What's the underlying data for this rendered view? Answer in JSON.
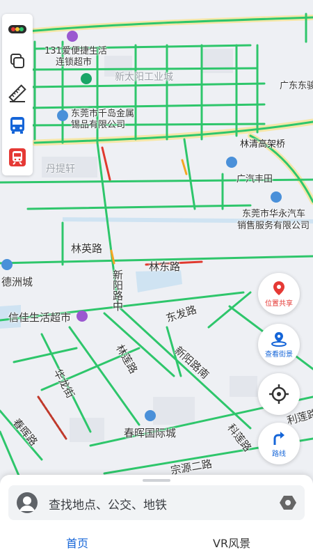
{
  "map": {
    "labels": {
      "shop131": "131爱便捷生活",
      "shop131b": "连锁超市",
      "xintaiyang": "新太阳工业城",
      "guangdong": "广东东骏",
      "qiandao1": "东莞市千岛金属",
      "qiandao2": "锡品有限公司",
      "linqing": "林清高架桥",
      "danti": "丹提轩",
      "guangqi": "广汽丰田",
      "huayong1": "东莞市华永汽车",
      "huayong2": "销售服务有限公司",
      "linying": "林英路",
      "lindong": "林东路",
      "dezhou": "德洲城",
      "xinyang": "新阳路中",
      "xinjia": "信佳生活超市",
      "dongfa": "东发路",
      "linlian": "林莲路",
      "xinyangnan": "新阳路南",
      "hualong": "华龙街",
      "chunhui": "春晖路",
      "chunhuiguoji": "春晖国际城",
      "kelian": "科莲路",
      "lilian": "利莲路",
      "zongyuan": "宗源二路"
    }
  },
  "toolbar": {
    "items": [
      "traffic-icon",
      "layers-icon",
      "ruler-icon",
      "bus-icon",
      "subway-icon"
    ]
  },
  "fabs": {
    "share": "位置共享",
    "street": "查看街景",
    "route": "路线"
  },
  "search": {
    "placeholder": "查找地点、公交、地铁"
  },
  "tabs": {
    "home": "首页",
    "vr": "VR风景"
  },
  "colors": {
    "road_green": "#2ec66b",
    "road_red": "#e03a2f",
    "road_orange": "#f4a623",
    "accent_blue": "#1565d8",
    "accent_red": "#e53935"
  }
}
